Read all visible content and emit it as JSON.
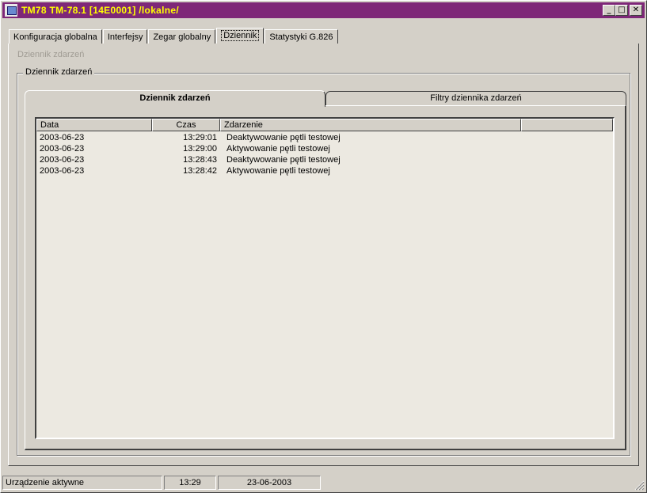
{
  "window": {
    "title": "TM78 TM-78.1 [14E0001] /lokalne/"
  },
  "title_buttons": {
    "minimize": "_",
    "maximize": "□",
    "close": "✕"
  },
  "main_tabs": [
    {
      "label": "Konfiguracja globalna"
    },
    {
      "label": "Interfejsy"
    },
    {
      "label": "Zegar globalny"
    },
    {
      "label": "Dziennik"
    },
    {
      "label": "Statystyki G.826"
    }
  ],
  "active_main_tab": "Dziennik",
  "page": {
    "subtitle": "Dziennik zdarzeń",
    "group_label": "Dziennik zdarzeń"
  },
  "inner_tabs": [
    {
      "label": "Dziennik zdarzeń"
    },
    {
      "label": "Filtry dziennika zdarzeń"
    }
  ],
  "table": {
    "columns": [
      "Data",
      "Czas",
      "Zdarzenie",
      ""
    ],
    "rows": [
      {
        "date": "2003-06-23",
        "time": "13:29:01",
        "event": "Deaktywowanie pętli testowej"
      },
      {
        "date": "2003-06-23",
        "time": "13:29:00",
        "event": "Aktywowanie pętli testowej"
      },
      {
        "date": "2003-06-23",
        "time": "13:28:43",
        "event": "Deaktywowanie pętli testowej"
      },
      {
        "date": "2003-06-23",
        "time": "13:28:42",
        "event": "Aktywowanie pętli testowej"
      }
    ]
  },
  "status": {
    "state": "Urządzenie aktywne",
    "time": "13:29",
    "date": "23-06-2003"
  },
  "colors": {
    "titlebar": "#7e2778",
    "title_text": "#ffff00",
    "face": "#d4d0c8"
  }
}
